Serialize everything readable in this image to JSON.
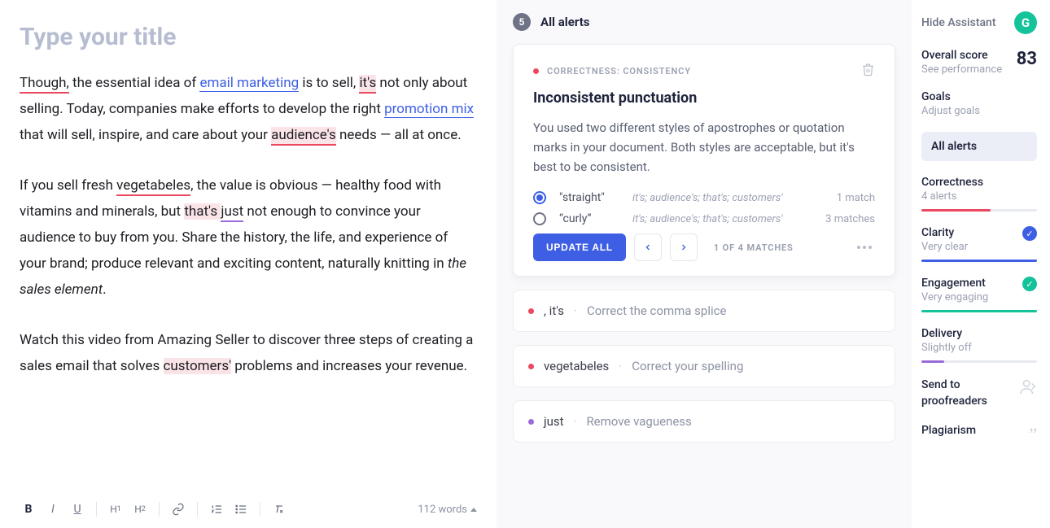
{
  "editor": {
    "title_placeholder": "Type your title",
    "p1": {
      "though": "Though,",
      "t1": " the essential idea of ",
      "link1": "email marketing",
      "t2": " is to sell, ",
      "its": "it's",
      "t3": " not only about selling. Today, companies make efforts to develop the right ",
      "link2": "promotion mix",
      "t4": " that will sell, inspire, and care about your ",
      "aud": "audience's",
      "t5": " needs — all at once."
    },
    "p2": {
      "t1": "If you sell fresh ",
      "veg": "vegetabeles",
      "t2": ", the value is obvious — healthy food with vitamins and minerals, but ",
      "thats": "that's ",
      "just": "just",
      "t3": " not enough to convince your audience to buy from you. Share the history, the life, and experience of your brand; produce relevant and exciting content, naturally knitting in ",
      "ital": "the sales element",
      "t4": "."
    },
    "p3": {
      "t1": "Watch this video from Amazing Seller to discover three steps of creating a sales email that solves ",
      "cust": "customers'",
      "t2": " problems and increases your revenue."
    },
    "word_count": "112 words"
  },
  "alerts": {
    "count": "5",
    "header": "All alerts",
    "card": {
      "eyebrow": "CORRECTNESS: CONSISTENCY",
      "title": "Inconsistent punctuation",
      "desc": "You used two different styles of apostrophes or quotation marks in your document. Both styles are acceptable, but it's best to be consistent.",
      "opt1": {
        "label": "\"straight\"",
        "examples": "it's; audience's; that's; customers'",
        "count": "1 match"
      },
      "opt2": {
        "label": "“curly”",
        "examples": "it's; audience's; that's; customers'",
        "count": "3 matches"
      },
      "update_btn": "UPDATE ALL",
      "match_label": "1 OF 4 MATCHES"
    },
    "mini": [
      {
        "word": ", it's",
        "msg": "Correct the comma splice"
      },
      {
        "word": "vegetabeles",
        "msg": "Correct your spelling"
      },
      {
        "word": "just",
        "msg": "Remove vagueness"
      }
    ]
  },
  "sidebar": {
    "hide": "Hide Assistant",
    "score_label": "Overall score",
    "score_sub": "See performance",
    "score": "83",
    "goals_label": "Goals",
    "goals_sub": "Adjust goals",
    "all_alerts": "All alerts",
    "correctness": {
      "label": "Correctness",
      "sub": "4 alerts"
    },
    "clarity": {
      "label": "Clarity",
      "sub": "Very clear"
    },
    "engagement": {
      "label": "Engagement",
      "sub": "Very engaging"
    },
    "delivery": {
      "label": "Delivery",
      "sub": "Slightly off"
    },
    "proof": "Send to proofreaders",
    "plag": "Plagiarism"
  }
}
